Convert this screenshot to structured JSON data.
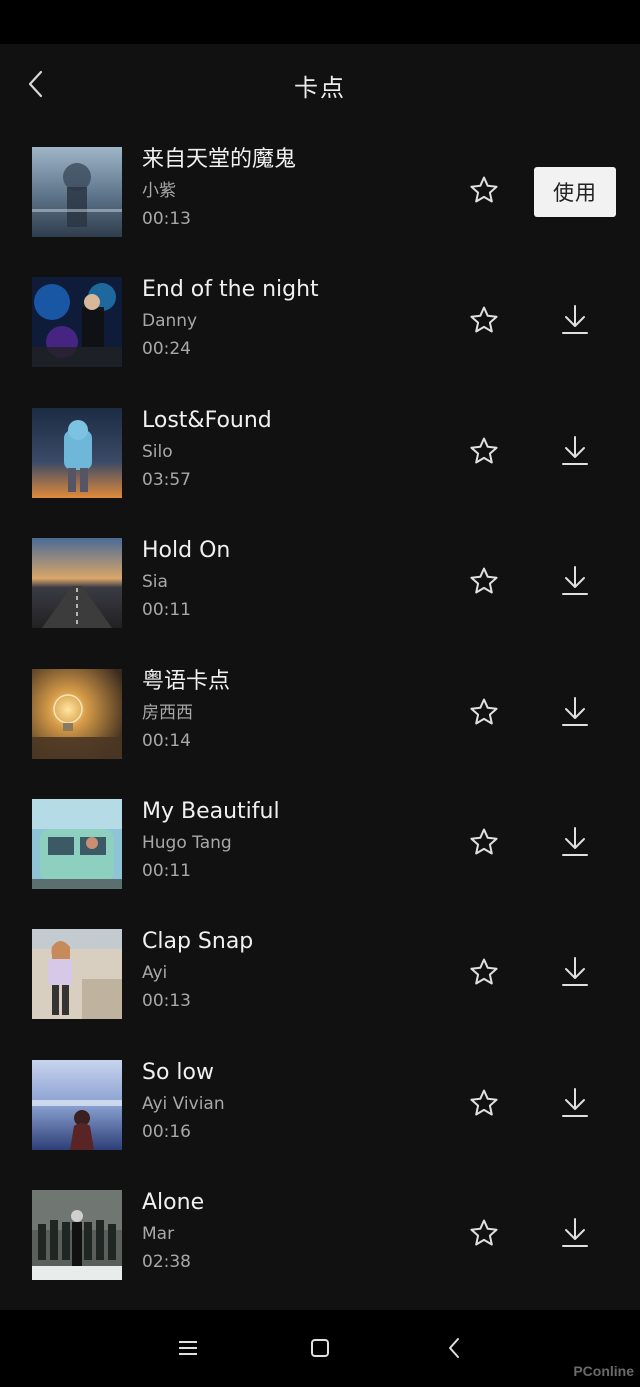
{
  "header": {
    "title": "卡点",
    "back_icon": "chevron-left-icon"
  },
  "songs": [
    {
      "title": "来自天堂的魔鬼",
      "artist": "小紫",
      "duration": "00:13",
      "action": "use"
    },
    {
      "title": "End of the night",
      "artist": "Danny",
      "duration": "00:24",
      "action": "download"
    },
    {
      "title": "Lost&Found",
      "artist": "Silo",
      "duration": "03:57",
      "action": "download"
    },
    {
      "title": "Hold On",
      "artist": "Sia",
      "duration": "00:11",
      "action": "download"
    },
    {
      "title": "粤语卡点",
      "artist": "房西西",
      "duration": "00:14",
      "action": "download"
    },
    {
      "title": "My Beautiful",
      "artist": "Hugo Tang",
      "duration": "00:11",
      "action": "download"
    },
    {
      "title": "Clap Snap",
      "artist": "Ayi",
      "duration": "00:13",
      "action": "download"
    },
    {
      "title": "So low",
      "artist": "Ayi Vivian",
      "duration": "00:16",
      "action": "download"
    },
    {
      "title": "Alone",
      "artist": "Mar",
      "duration": "02:38",
      "action": "download"
    }
  ],
  "use_label": "使用",
  "icons": {
    "favorite": "star-outline-icon",
    "download": "download-icon"
  },
  "nav": {
    "menu_icon": "menu-icon",
    "home_icon": "square-home-icon",
    "back_icon": "triangle-back-icon"
  },
  "watermark": "PConline",
  "colors": {
    "background": "#111111",
    "system_bars": "#000000",
    "text_primary": "#f0f0f0",
    "text_secondary": "#a8a8a8",
    "use_button_bg": "#f2f2f2"
  }
}
